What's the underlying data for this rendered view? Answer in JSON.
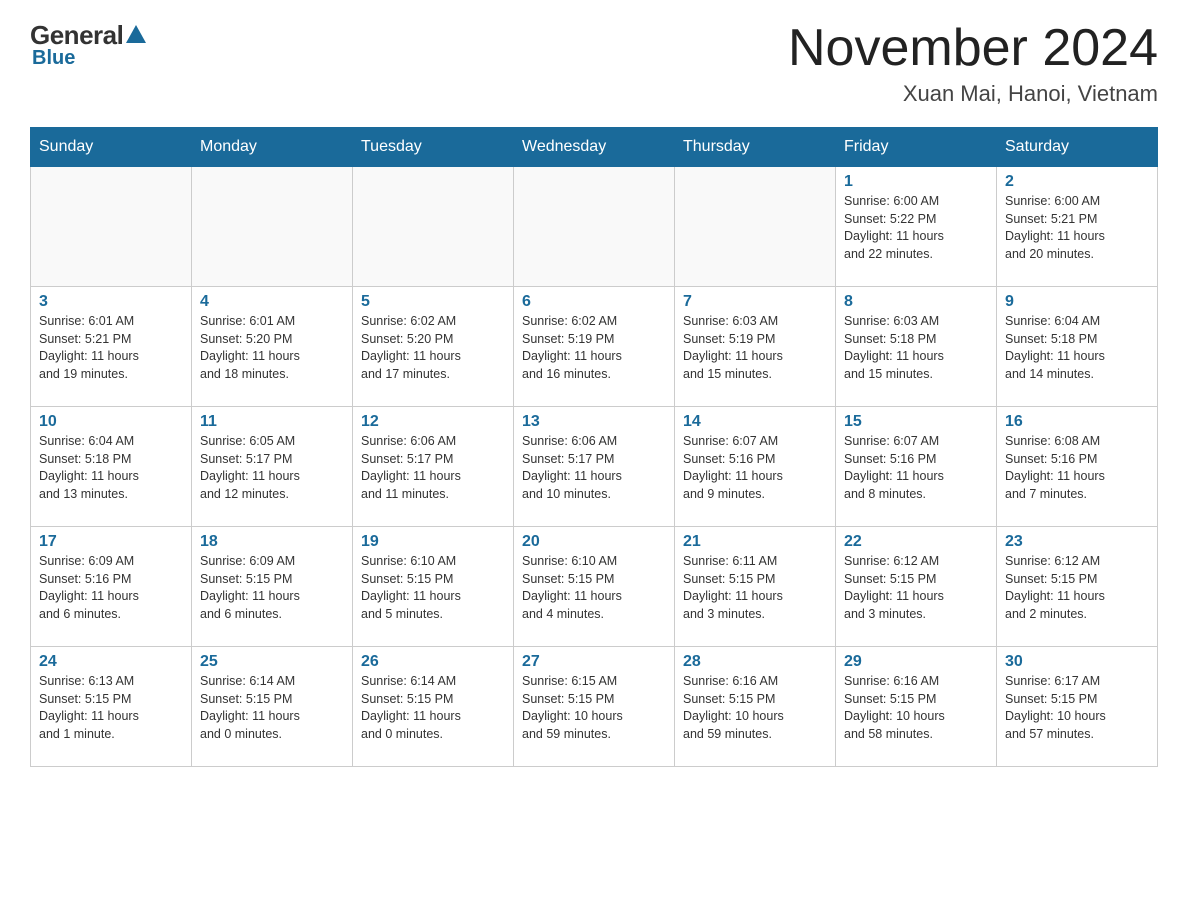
{
  "logo": {
    "general_text": "General",
    "blue_text": "Blue"
  },
  "header": {
    "month_title": "November 2024",
    "location": "Xuan Mai, Hanoi, Vietnam"
  },
  "days_of_week": [
    "Sunday",
    "Monday",
    "Tuesday",
    "Wednesday",
    "Thursday",
    "Friday",
    "Saturday"
  ],
  "weeks": [
    [
      {
        "day": "",
        "info": ""
      },
      {
        "day": "",
        "info": ""
      },
      {
        "day": "",
        "info": ""
      },
      {
        "day": "",
        "info": ""
      },
      {
        "day": "",
        "info": ""
      },
      {
        "day": "1",
        "info": "Sunrise: 6:00 AM\nSunset: 5:22 PM\nDaylight: 11 hours\nand 22 minutes."
      },
      {
        "day": "2",
        "info": "Sunrise: 6:00 AM\nSunset: 5:21 PM\nDaylight: 11 hours\nand 20 minutes."
      }
    ],
    [
      {
        "day": "3",
        "info": "Sunrise: 6:01 AM\nSunset: 5:21 PM\nDaylight: 11 hours\nand 19 minutes."
      },
      {
        "day": "4",
        "info": "Sunrise: 6:01 AM\nSunset: 5:20 PM\nDaylight: 11 hours\nand 18 minutes."
      },
      {
        "day": "5",
        "info": "Sunrise: 6:02 AM\nSunset: 5:20 PM\nDaylight: 11 hours\nand 17 minutes."
      },
      {
        "day": "6",
        "info": "Sunrise: 6:02 AM\nSunset: 5:19 PM\nDaylight: 11 hours\nand 16 minutes."
      },
      {
        "day": "7",
        "info": "Sunrise: 6:03 AM\nSunset: 5:19 PM\nDaylight: 11 hours\nand 15 minutes."
      },
      {
        "day": "8",
        "info": "Sunrise: 6:03 AM\nSunset: 5:18 PM\nDaylight: 11 hours\nand 15 minutes."
      },
      {
        "day": "9",
        "info": "Sunrise: 6:04 AM\nSunset: 5:18 PM\nDaylight: 11 hours\nand 14 minutes."
      }
    ],
    [
      {
        "day": "10",
        "info": "Sunrise: 6:04 AM\nSunset: 5:18 PM\nDaylight: 11 hours\nand 13 minutes."
      },
      {
        "day": "11",
        "info": "Sunrise: 6:05 AM\nSunset: 5:17 PM\nDaylight: 11 hours\nand 12 minutes."
      },
      {
        "day": "12",
        "info": "Sunrise: 6:06 AM\nSunset: 5:17 PM\nDaylight: 11 hours\nand 11 minutes."
      },
      {
        "day": "13",
        "info": "Sunrise: 6:06 AM\nSunset: 5:17 PM\nDaylight: 11 hours\nand 10 minutes."
      },
      {
        "day": "14",
        "info": "Sunrise: 6:07 AM\nSunset: 5:16 PM\nDaylight: 11 hours\nand 9 minutes."
      },
      {
        "day": "15",
        "info": "Sunrise: 6:07 AM\nSunset: 5:16 PM\nDaylight: 11 hours\nand 8 minutes."
      },
      {
        "day": "16",
        "info": "Sunrise: 6:08 AM\nSunset: 5:16 PM\nDaylight: 11 hours\nand 7 minutes."
      }
    ],
    [
      {
        "day": "17",
        "info": "Sunrise: 6:09 AM\nSunset: 5:16 PM\nDaylight: 11 hours\nand 6 minutes."
      },
      {
        "day": "18",
        "info": "Sunrise: 6:09 AM\nSunset: 5:15 PM\nDaylight: 11 hours\nand 6 minutes."
      },
      {
        "day": "19",
        "info": "Sunrise: 6:10 AM\nSunset: 5:15 PM\nDaylight: 11 hours\nand 5 minutes."
      },
      {
        "day": "20",
        "info": "Sunrise: 6:10 AM\nSunset: 5:15 PM\nDaylight: 11 hours\nand 4 minutes."
      },
      {
        "day": "21",
        "info": "Sunrise: 6:11 AM\nSunset: 5:15 PM\nDaylight: 11 hours\nand 3 minutes."
      },
      {
        "day": "22",
        "info": "Sunrise: 6:12 AM\nSunset: 5:15 PM\nDaylight: 11 hours\nand 3 minutes."
      },
      {
        "day": "23",
        "info": "Sunrise: 6:12 AM\nSunset: 5:15 PM\nDaylight: 11 hours\nand 2 minutes."
      }
    ],
    [
      {
        "day": "24",
        "info": "Sunrise: 6:13 AM\nSunset: 5:15 PM\nDaylight: 11 hours\nand 1 minute."
      },
      {
        "day": "25",
        "info": "Sunrise: 6:14 AM\nSunset: 5:15 PM\nDaylight: 11 hours\nand 0 minutes."
      },
      {
        "day": "26",
        "info": "Sunrise: 6:14 AM\nSunset: 5:15 PM\nDaylight: 11 hours\nand 0 minutes."
      },
      {
        "day": "27",
        "info": "Sunrise: 6:15 AM\nSunset: 5:15 PM\nDaylight: 10 hours\nand 59 minutes."
      },
      {
        "day": "28",
        "info": "Sunrise: 6:16 AM\nSunset: 5:15 PM\nDaylight: 10 hours\nand 59 minutes."
      },
      {
        "day": "29",
        "info": "Sunrise: 6:16 AM\nSunset: 5:15 PM\nDaylight: 10 hours\nand 58 minutes."
      },
      {
        "day": "30",
        "info": "Sunrise: 6:17 AM\nSunset: 5:15 PM\nDaylight: 10 hours\nand 57 minutes."
      }
    ]
  ]
}
